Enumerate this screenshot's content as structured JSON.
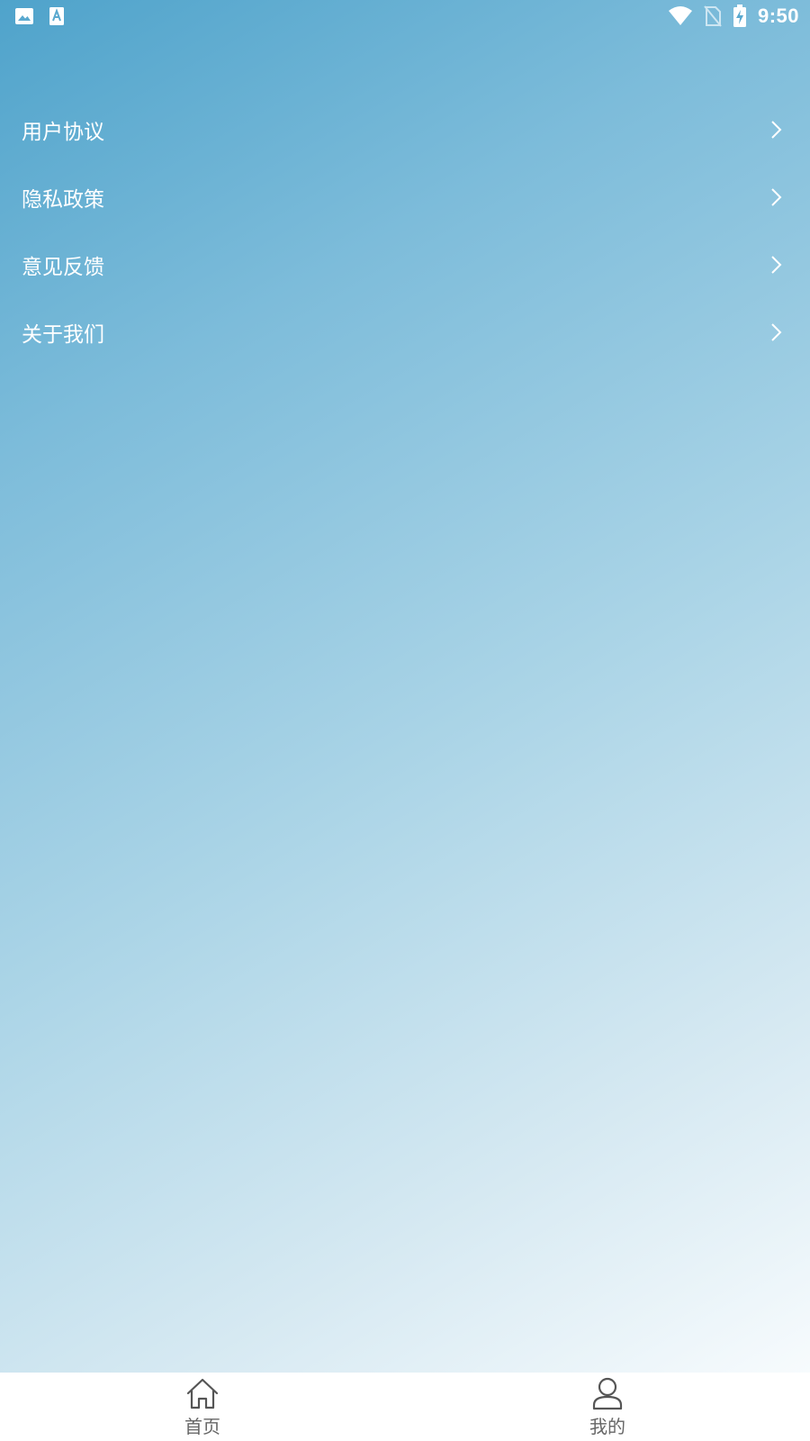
{
  "status_bar": {
    "left_icons": [
      "image-icon",
      "text-a-icon"
    ],
    "right_icons": [
      "wifi-icon",
      "no-sim-icon",
      "battery-charging-icon"
    ],
    "time": "9:50"
  },
  "menu": {
    "items": [
      {
        "label": "用户协议",
        "icon": "chevron-right-icon"
      },
      {
        "label": "隐私政策",
        "icon": "chevron-right-icon"
      },
      {
        "label": "意见反馈",
        "icon": "chevron-right-icon"
      },
      {
        "label": "关于我们",
        "icon": "chevron-right-icon"
      }
    ]
  },
  "tab_bar": {
    "tabs": [
      {
        "label": "首页",
        "icon": "home-icon"
      },
      {
        "label": "我的",
        "icon": "user-icon"
      }
    ]
  },
  "colors": {
    "gradient_start": "#4fa3cb",
    "gradient_end": "#f7fbfd",
    "menu_text": "#ffffff",
    "tab_label": "#666666",
    "tab_bar_bg": "#ffffff"
  }
}
